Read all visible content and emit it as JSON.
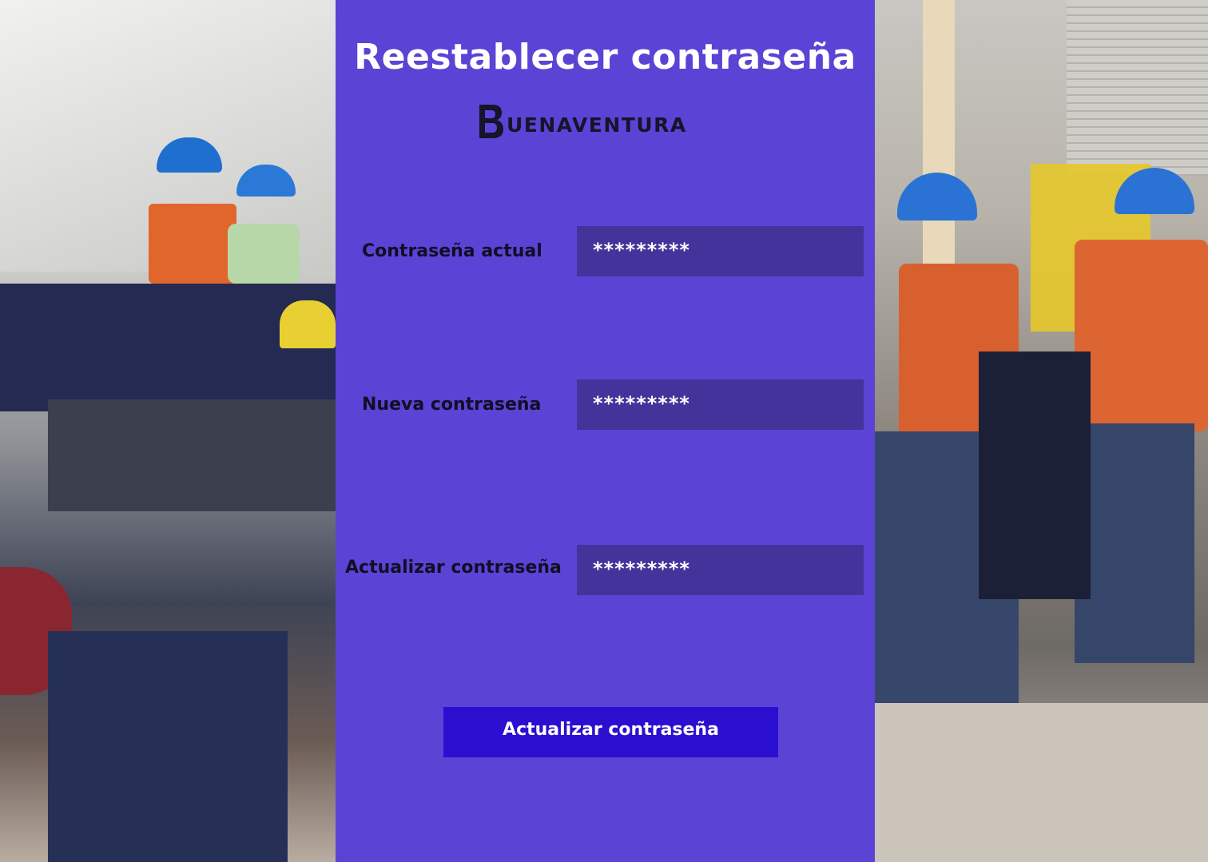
{
  "page": {
    "title": "Reestablecer contraseña",
    "brand": {
      "letter": "B",
      "name": "UENAVENTURA"
    }
  },
  "form": {
    "fields": [
      {
        "label": "Contraseña actual",
        "value": "*********"
      },
      {
        "label": "Nueva contraseña",
        "value": "*********"
      },
      {
        "label": "Actualizar contraseña",
        "value": "*********"
      }
    ],
    "submit_label": "Actualizar contraseña"
  },
  "colors": {
    "panel": "#5b43d6",
    "field": "#44339a",
    "button": "#2a0fd0",
    "label_text": "#0f0f25",
    "title_text": "#ffffff"
  },
  "icons": [
    "buenaventura-logo-icon"
  ]
}
